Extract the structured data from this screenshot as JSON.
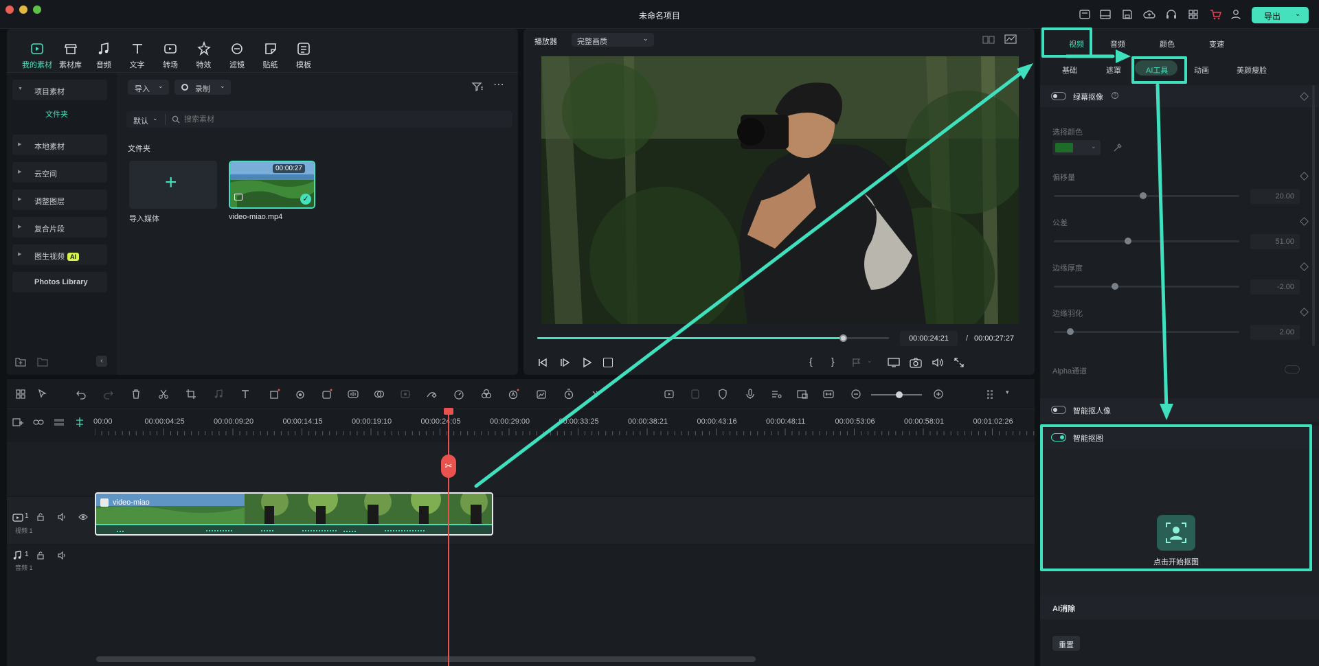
{
  "window": {
    "title": "未命名项目",
    "export_label": "导出"
  },
  "media_tabs": [
    {
      "label": "我的素材",
      "icon": "my-media-icon"
    },
    {
      "label": "素材库",
      "icon": "stock-icon"
    },
    {
      "label": "音频",
      "icon": "music-note-icon"
    },
    {
      "label": "文字",
      "icon": "text-icon"
    },
    {
      "label": "转场",
      "icon": "transition-icon"
    },
    {
      "label": "特效",
      "icon": "effects-icon"
    },
    {
      "label": "滤镜",
      "icon": "filter-icon"
    },
    {
      "label": "贴纸",
      "icon": "sticker-icon"
    },
    {
      "label": "模板",
      "icon": "template-icon"
    }
  ],
  "media_sidebar": {
    "project_media": "项目素材",
    "folder": "文件夹",
    "items": [
      "本地素材",
      "云空间",
      "调整图层",
      "复合片段",
      "图生视频"
    ],
    "ai_badge": "AI",
    "photos": "Photos Library"
  },
  "media_toolbar": {
    "import": "导入",
    "record": "录制",
    "sort": "默认",
    "search_placeholder": "搜索素材"
  },
  "media_grid": {
    "section": "文件夹",
    "import_label": "导入媒体",
    "clip": {
      "name": "video-miao.mp4",
      "duration": "00:00:27"
    }
  },
  "preview": {
    "label": "播放器",
    "quality": "完整画质",
    "current_time": "00:00:24:21",
    "separator": "/",
    "total_time": "00:00:27:27",
    "progress": 0.87
  },
  "timeline": {
    "ruler": [
      "00:00",
      "00:00:04:25",
      "00:00:09:20",
      "00:00:14:15",
      "00:00:19:10",
      "00:00:24:05",
      "00:00:29:00",
      "00:00:33:25",
      "00:00:38:21",
      "00:00:43:16",
      "00:00:48:11",
      "00:00:53:06",
      "00:00:58:01",
      "00:01:02:26"
    ],
    "video_track": {
      "num": "1",
      "label": "视频 1"
    },
    "audio_track": {
      "num": "1",
      "label": "音频 1"
    },
    "clip_name": "video-miao"
  },
  "props": {
    "tabs": [
      "视频",
      "音频",
      "颜色",
      "变速"
    ],
    "subtabs": [
      "基础",
      "遮罩",
      "AI工具",
      "动画",
      "美颜瘦脸"
    ],
    "chroma": {
      "title": "绿幕抠像",
      "color_label": "选择颜色",
      "swatch": "#1f6b2a"
    },
    "params": [
      {
        "label": "偏移量",
        "value": "20.00",
        "level": 0.48
      },
      {
        "label": "公差",
        "value": "51.00",
        "level": 0.4
      },
      {
        "label": "边缘厚度",
        "value": "-2.00",
        "level": 0.33
      },
      {
        "label": "边缘羽化",
        "value": "2.00",
        "level": 0.09
      }
    ],
    "alpha": "Alpha通道",
    "smart_portrait": "智能抠人像",
    "smart_cutout": "智能抠图",
    "start_cutout": "点击开始抠图",
    "ai_erase": "AI消除",
    "reset": "重置"
  },
  "colors": {
    "accent": "#45e0bc",
    "highlight": "#3fe0bd",
    "playhead": "#e8534f"
  }
}
